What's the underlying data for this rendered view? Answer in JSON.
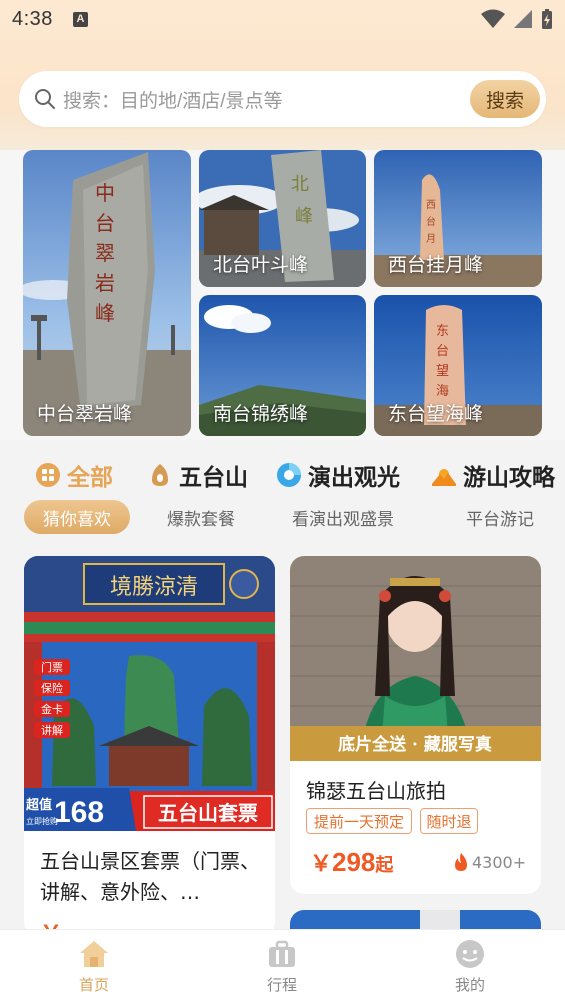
{
  "status_bar": {
    "time": "4:38",
    "indicator": "A"
  },
  "search": {
    "placeholder": "搜索：目的地/酒店/景点等",
    "button_label": "搜索"
  },
  "peaks": [
    {
      "name": "中台翠岩峰"
    },
    {
      "name": "北台叶斗峰"
    },
    {
      "name": "西台挂月峰"
    },
    {
      "name": "南台锦绣峰"
    },
    {
      "name": "东台望海峰"
    }
  ],
  "categories": [
    {
      "label": "全部",
      "icon": "grid-icon",
      "color": "#e6a557"
    },
    {
      "label": "五台山",
      "icon": "bell-icon"
    },
    {
      "label": "演出观光",
      "icon": "disc-icon"
    },
    {
      "label": "游山攻略",
      "icon": "mountain-sun-icon"
    }
  ],
  "subtabs": [
    {
      "label": "猜你喜欢",
      "active": true
    },
    {
      "label": "爆款套餐"
    },
    {
      "label": "看演出观盛景"
    },
    {
      "label": "平台游记"
    }
  ],
  "cards": {
    "left": {
      "title": "五台山景区套票（门票、讲解、意外险、…",
      "price_partial": "￥",
      "image": {
        "top_sign": "境勝涼清",
        "badges": [
          "门票",
          "保险",
          "金卡",
          "讲解"
        ],
        "promo_prefix": "超值",
        "promo_sub": "立即抢购",
        "promo_price": "168",
        "banner": "五台山套票"
      }
    },
    "right": {
      "title": "锦瑟五台山旅拍",
      "image_banner": "底片全送 · 藏服写真",
      "tags": [
        "提前一天预定",
        "随时退"
      ],
      "price_symbol": "￥",
      "price_value": "298",
      "price_suffix": "起",
      "sales": "4300+"
    }
  },
  "bottom_nav": [
    {
      "label": "首页",
      "active": true
    },
    {
      "label": "行程"
    },
    {
      "label": "我的"
    }
  ],
  "colors": {
    "accent": "#d9a45b",
    "price": "#ef5a23",
    "header_bg": "#fbe4c9"
  }
}
